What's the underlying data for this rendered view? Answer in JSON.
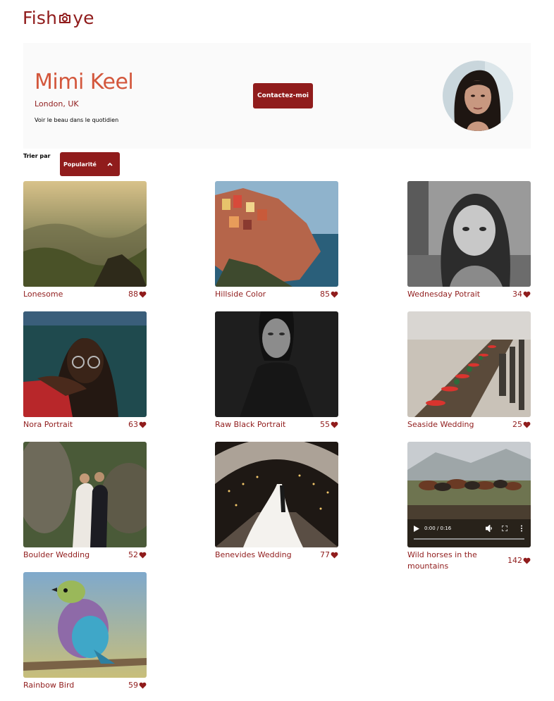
{
  "brand": {
    "logo_left": "Fish",
    "logo_right": "ye"
  },
  "photographer": {
    "name": "Mimi Keel",
    "location": "London, UK",
    "tagline": "Voir le beau dans le quotidien",
    "contact_label": "Contactez-moi"
  },
  "sort": {
    "label": "Trier par",
    "selected": "Popularité"
  },
  "media": [
    {
      "title": "Lonesome",
      "likes": "88"
    },
    {
      "title": "Hillside Color",
      "likes": "85"
    },
    {
      "title": "Wednesday Potrait",
      "likes": "34"
    },
    {
      "title": "Nora Portrait",
      "likes": "63"
    },
    {
      "title": "Raw Black Portrait",
      "likes": "55"
    },
    {
      "title": "Seaside Wedding",
      "likes": "25"
    },
    {
      "title": "Boulder Wedding",
      "likes": "52"
    },
    {
      "title": "Benevides Wedding",
      "likes": "77"
    },
    {
      "title": "Wild horses in the mountains",
      "likes": "142",
      "video_time": "0:00 / 0:16"
    },
    {
      "title": "Rainbow Bird",
      "likes": "59"
    }
  ],
  "colors": {
    "primary": "#901C1C",
    "accent": "#D3573C",
    "header_bg": "#FAFAFA"
  },
  "icons": {
    "logo_mark": "camera-icon",
    "like": "heart-icon",
    "sort_toggle": "chevron-up-icon"
  }
}
